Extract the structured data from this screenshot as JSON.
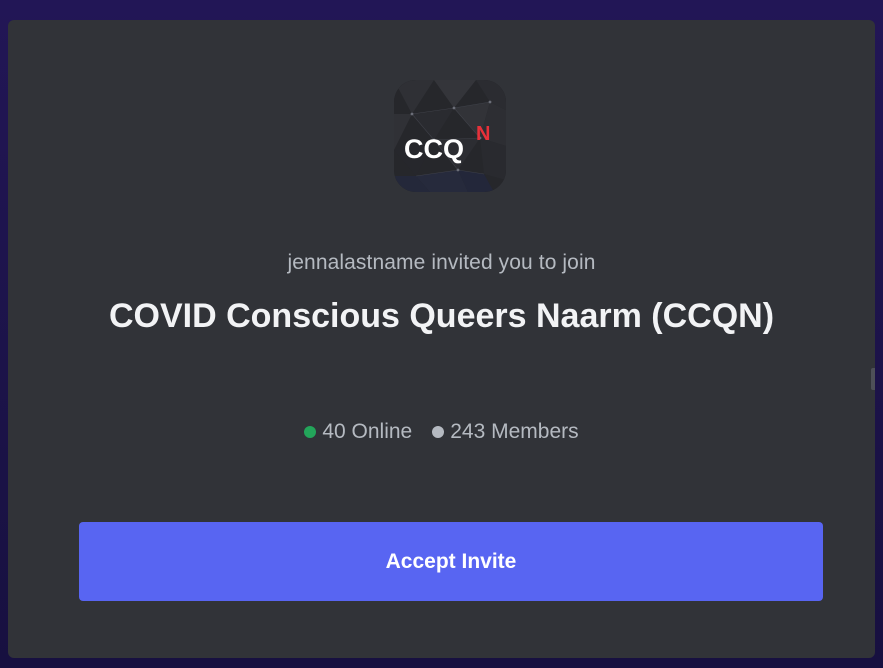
{
  "server": {
    "icon_text": "CCQ",
    "icon_superscript": "N",
    "icon_name": "server-icon",
    "inviter_line": "jennalastname invited you to join",
    "name": "COVID Conscious Queers Naarm (CCQN)"
  },
  "stats": {
    "online_label": "40 Online",
    "members_label": "243 Members",
    "online_color": "#23a55a",
    "members_color": "#b5bac1"
  },
  "actions": {
    "accept_label": "Accept Invite"
  },
  "colors": {
    "accent": "#5865f2",
    "card_bg": "#313338",
    "backdrop": "#1e1452"
  }
}
